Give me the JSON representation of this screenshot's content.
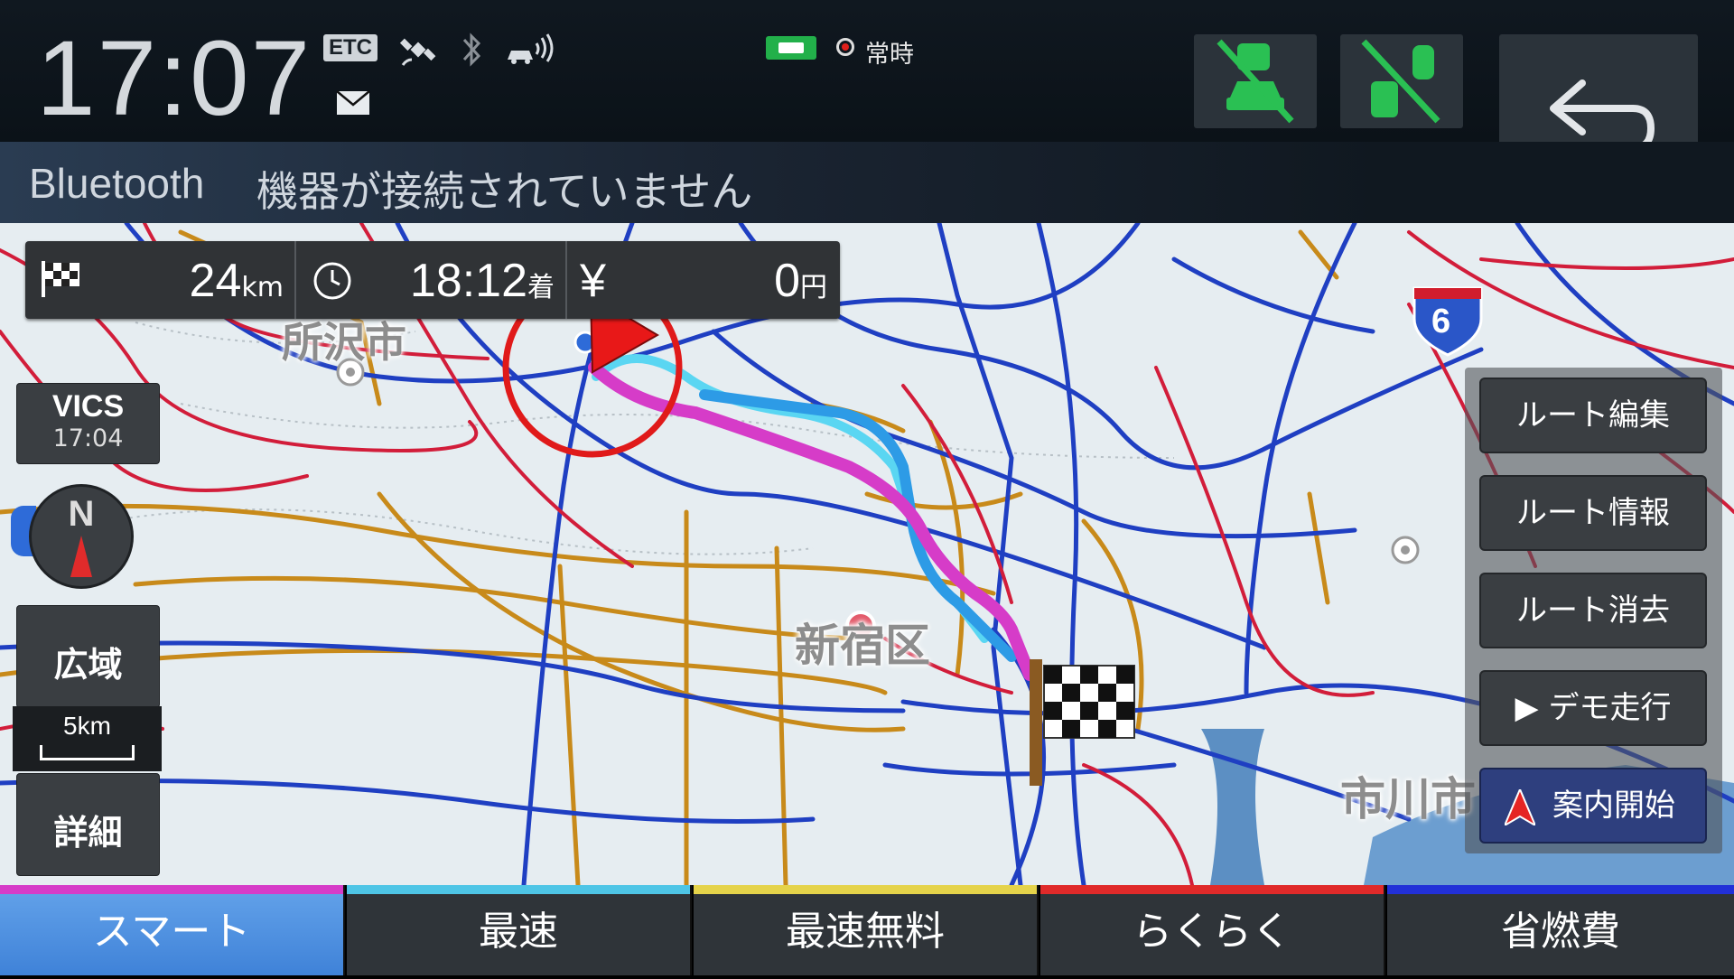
{
  "status": {
    "clock": "17:07",
    "etc_label": "ETC",
    "rec_label": "常時"
  },
  "banner": {
    "label": "Bluetooth",
    "message": "機器が接続されていません"
  },
  "route_info": {
    "distance": "24",
    "distance_unit": "km",
    "arrival": "18:12",
    "arrival_suffix": "着",
    "currency": "¥",
    "toll": "0",
    "toll_unit": "円"
  },
  "vics": {
    "label": "VICS",
    "time": "17:04"
  },
  "compass": "N",
  "zoom": {
    "wide_label": "広域",
    "scale": "5km",
    "detail_label": "詳細"
  },
  "map_labels": {
    "tokorozawa": "所沢市",
    "shinjuku": "新宿区",
    "ichikawa": "市川市",
    "route_number": "6"
  },
  "menu": [
    {
      "label": "ルート編集"
    },
    {
      "label": "ルート情報"
    },
    {
      "label": "ルート消去"
    },
    {
      "label": "▶ デモ走行"
    },
    {
      "label": "案内開始"
    }
  ],
  "tabs": [
    {
      "label": "スマート",
      "color": "#d63cc8"
    },
    {
      "label": "最速",
      "color": "#4ec5e6"
    },
    {
      "label": "最速無料",
      "color": "#e5d34a"
    },
    {
      "label": "らくらく",
      "color": "#e02a2a"
    },
    {
      "label": "省燃費",
      "color": "#2230d8"
    }
  ],
  "colors": {
    "active_tab": "#4f93e0",
    "route_smart": "#d63cc8",
    "route_fastest": "#2d9be6"
  }
}
